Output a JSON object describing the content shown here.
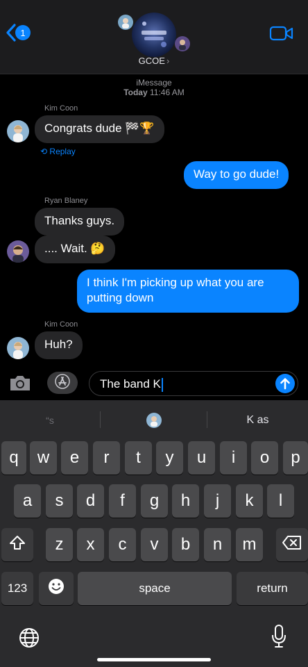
{
  "header": {
    "unread_count": "1",
    "group_name": "GCOE",
    "group_chevron": "›"
  },
  "conversation": {
    "service": "iMessage",
    "timestamp_day": "Today",
    "timestamp_time": "11:46 AM",
    "replay_label": "Replay",
    "messages": [
      {
        "sender": "Kim Coon",
        "text": "Congrats dude 🏁🏆",
        "direction": "received"
      },
      {
        "text": "Way to go dude!",
        "direction": "sent"
      },
      {
        "sender": "Ryan Blaney",
        "text": "Thanks guys.",
        "direction": "received"
      },
      {
        "text": ".... Wait. 🤔",
        "direction": "received"
      },
      {
        "text": "I think I'm picking up what you are putting down",
        "direction": "sent"
      },
      {
        "sender": "Kim Coon",
        "text": "Huh?",
        "direction": "received"
      }
    ]
  },
  "input": {
    "value": "The band K"
  },
  "keyboard": {
    "predictions": [
      "“s",
      "",
      "K as"
    ],
    "row1": [
      "q",
      "w",
      "e",
      "r",
      "t",
      "y",
      "u",
      "i",
      "o",
      "p"
    ],
    "row2": [
      "a",
      "s",
      "d",
      "f",
      "g",
      "h",
      "j",
      "k",
      "l"
    ],
    "row3": [
      "z",
      "x",
      "c",
      "v",
      "b",
      "n",
      "m"
    ],
    "numbers_label": "123",
    "space_label": "space",
    "return_label": "return"
  },
  "icons": {
    "back": "chevron-left-icon",
    "video": "video-camera-icon",
    "camera": "camera-icon",
    "apps": "app-store-icon",
    "send": "arrow-up-icon",
    "shift": "shift-icon",
    "delete": "delete-icon",
    "emoji": "emoji-icon",
    "globe": "globe-icon",
    "mic": "microphone-icon"
  },
  "colors": {
    "accent": "#0a84ff",
    "received_bubble": "#262628",
    "header_bg": "#1c1c1e",
    "keyboard_bg": "#2b2b2d"
  }
}
